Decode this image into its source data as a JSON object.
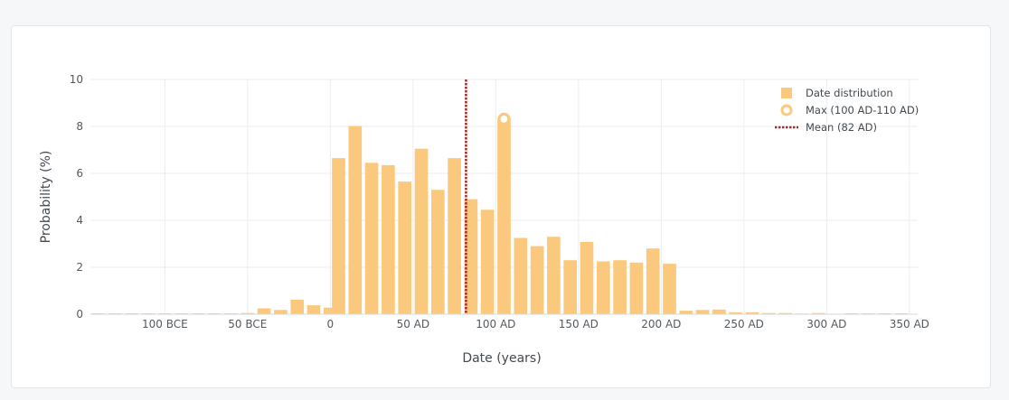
{
  "chart_data": {
    "type": "bar",
    "xlabel": "Date (years)",
    "ylabel": "Probability (%)",
    "xlim": [
      -145,
      355
    ],
    "ylim": [
      0,
      10
    ],
    "x_ticks": [
      {
        "value": -100,
        "label": "100 BCE"
      },
      {
        "value": -50,
        "label": "50 BCE"
      },
      {
        "value": 0,
        "label": "0"
      },
      {
        "value": 50,
        "label": "50 AD"
      },
      {
        "value": 100,
        "label": "100 AD"
      },
      {
        "value": 150,
        "label": "150 AD"
      },
      {
        "value": 200,
        "label": "200 AD"
      },
      {
        "value": 250,
        "label": "250 AD"
      },
      {
        "value": 300,
        "label": "300 AD"
      },
      {
        "value": 350,
        "label": "350 AD"
      }
    ],
    "y_ticks": [
      0,
      2,
      4,
      6,
      8,
      10
    ],
    "bin_width": 10,
    "series": [
      {
        "name": "Date distribution",
        "color": "#fbc97d",
        "bins": [
          {
            "x": -140,
            "y": 0
          },
          {
            "x": -130,
            "y": 0
          },
          {
            "x": -120,
            "y": 0
          },
          {
            "x": -110,
            "y": 0
          },
          {
            "x": -100,
            "y": 0
          },
          {
            "x": -90,
            "y": 0
          },
          {
            "x": -80,
            "y": 0
          },
          {
            "x": -70,
            "y": 0
          },
          {
            "x": -60,
            "y": 0
          },
          {
            "x": -50,
            "y": 0.05
          },
          {
            "x": -40,
            "y": 0.25
          },
          {
            "x": -30,
            "y": 0.18
          },
          {
            "x": -20,
            "y": 0.62
          },
          {
            "x": -10,
            "y": 0.38
          },
          {
            "x": 0,
            "y": 0.28
          },
          {
            "x": 5,
            "y": 6.65
          },
          {
            "x": 15,
            "y": 8.02
          },
          {
            "x": 25,
            "y": 6.45
          },
          {
            "x": 35,
            "y": 6.35
          },
          {
            "x": 45,
            "y": 5.65
          },
          {
            "x": 55,
            "y": 7.05
          },
          {
            "x": 65,
            "y": 5.3
          },
          {
            "x": 75,
            "y": 6.65
          },
          {
            "x": 85,
            "y": 4.9
          },
          {
            "x": 95,
            "y": 4.45
          },
          {
            "x": 105,
            "y": 8.35
          },
          {
            "x": 115,
            "y": 3.25
          },
          {
            "x": 125,
            "y": 2.9
          },
          {
            "x": 135,
            "y": 3.3
          },
          {
            "x": 145,
            "y": 2.3
          },
          {
            "x": 155,
            "y": 3.08
          },
          {
            "x": 165,
            "y": 2.25
          },
          {
            "x": 175,
            "y": 2.3
          },
          {
            "x": 185,
            "y": 2.2
          },
          {
            "x": 195,
            "y": 2.8
          },
          {
            "x": 205,
            "y": 2.15
          },
          {
            "x": 215,
            "y": 0.15
          },
          {
            "x": 225,
            "y": 0.18
          },
          {
            "x": 235,
            "y": 0.2
          },
          {
            "x": 245,
            "y": 0.08
          },
          {
            "x": 255,
            "y": 0.08
          },
          {
            "x": 265,
            "y": 0.05
          },
          {
            "x": 275,
            "y": 0.05
          },
          {
            "x": 285,
            "y": 0.03
          },
          {
            "x": 295,
            "y": 0.05
          },
          {
            "x": 305,
            "y": 0.02
          },
          {
            "x": 315,
            "y": 0
          },
          {
            "x": 325,
            "y": 0
          },
          {
            "x": 335,
            "y": 0
          },
          {
            "x": 345,
            "y": 0
          }
        ]
      }
    ],
    "max_marker": {
      "label": "Max (100 AD-110 AD)",
      "x": 105,
      "y": 8.35,
      "color": "#fbc97d"
    },
    "mean_line": {
      "label": "Mean (82 AD)",
      "x": 82,
      "color": "#a52a2a"
    },
    "grid": true,
    "legend_position": "top-right"
  }
}
